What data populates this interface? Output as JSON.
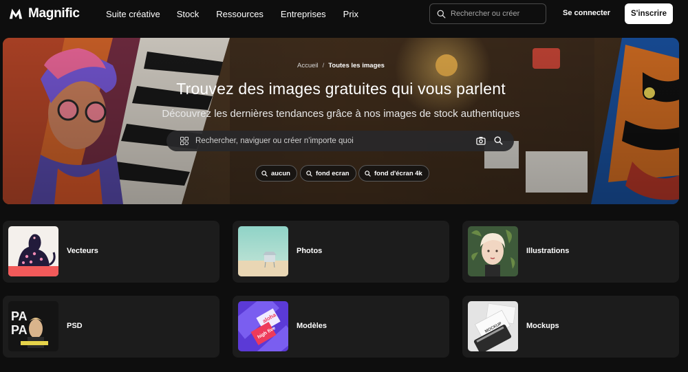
{
  "brand": {
    "name": "Magnific"
  },
  "nav": {
    "links": [
      "Suite créative",
      "Stock",
      "Ressources",
      "Entreprises",
      "Prix"
    ],
    "search_placeholder": "Rechercher ou créer",
    "login_label": "Se connecter",
    "signup_label": "S'inscrire"
  },
  "hero": {
    "breadcrumb": {
      "home": "Accueil",
      "separator": "/",
      "current": "Toutes les images"
    },
    "title": "Trouvez des images gratuites qui vous parlent",
    "subtitle": "Découvrez les dernières tendances grâce à nos images de stock authentiques",
    "search_placeholder": "Rechercher, naviguer ou créer n'importe quoi",
    "chips": [
      "aucun",
      "fond ecran",
      "fond d'écran 4k"
    ]
  },
  "categories": [
    {
      "label": "Vecteurs",
      "thumb": "leopard-vector"
    },
    {
      "label": "Photos",
      "thumb": "lifeguard-beach"
    },
    {
      "label": "Illustrations",
      "thumb": "woman-portrait-leaves"
    },
    {
      "label": "PSD",
      "thumb": "party-flyer"
    },
    {
      "label": "Modèles",
      "thumb": "aloha-cards"
    },
    {
      "label": "Mockups",
      "thumb": "business-card-mockup"
    }
  ],
  "colors": {
    "background": "#0e0e0e",
    "card": "#1c1c1c",
    "accent_white": "#ffffff"
  }
}
